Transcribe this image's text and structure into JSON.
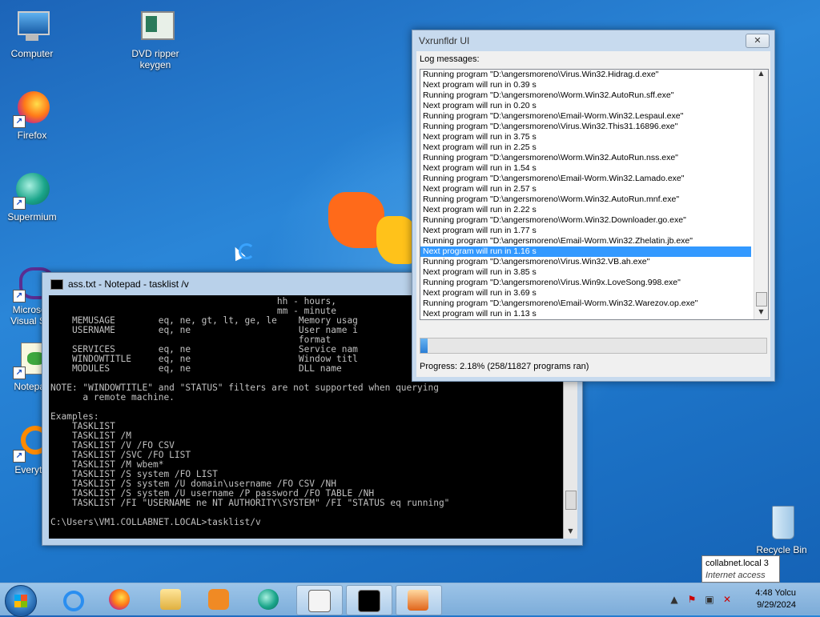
{
  "desktop": {
    "icons": [
      {
        "label": "Computer"
      },
      {
        "label": "DVD ripper keygen"
      },
      {
        "label": "Firefox"
      },
      {
        "label": "Supermium"
      },
      {
        "label": "Microsoft Visual Stu"
      },
      {
        "label": "Notepad"
      },
      {
        "label": "Everythi"
      },
      {
        "label": "Recycle Bin"
      }
    ]
  },
  "cmd_window": {
    "title": "ass.txt - Notepad - tasklist /v",
    "lines": [
      "                                          hh - hours,",
      "                                          mm - minute",
      "    MEMUSAGE        eq, ne, gt, lt, ge, le    Memory usag",
      "    USERNAME        eq, ne                    User name i",
      "                                              format",
      "    SERVICES        eq, ne                    Service nam",
      "    WINDOWTITLE     eq, ne                    Window titl",
      "    MODULES         eq, ne                    DLL name",
      "",
      "NOTE: \"WINDOWTITLE\" and \"STATUS\" filters are not supported when querying",
      "      a remote machine.",
      "",
      "Examples:",
      "    TASKLIST",
      "    TASKLIST /M",
      "    TASKLIST /V /FO CSV",
      "    TASKLIST /SVC /FO LIST",
      "    TASKLIST /M wbem*",
      "    TASKLIST /S system /FO LIST",
      "    TASKLIST /S system /U domain\\username /FO CSV /NH",
      "    TASKLIST /S system /U username /P password /FO TABLE /NH",
      "    TASKLIST /FI \"USERNAME ne NT AUTHORITY\\SYSTEM\" /FI \"STATUS eq running\"",
      "",
      "C:\\Users\\VM1.COLLABNET.LOCAL>tasklist/v"
    ]
  },
  "vx_window": {
    "title": "Vxrunfldr UI",
    "close_label": "✕",
    "log_label": "Log messages:",
    "log": [
      "Running program \"D:\\angersmoreno\\Virus.Win32.Hidrag.d.exe\"",
      "Next program will run in 0.39 s",
      "Running program \"D:\\angersmoreno\\Worm.Win32.AutoRun.sff.exe\"",
      "Next program will run in 0.20 s",
      "Running program \"D:\\angersmoreno\\Email-Worm.Win32.Lespaul.exe\"",
      "Running program \"D:\\angersmoreno\\Virus.Win32.This31.16896.exe\"",
      "Next program will run in 3.75 s",
      "Next program will run in 2.25 s",
      "Running program \"D:\\angersmoreno\\Worm.Win32.AutoRun.nss.exe\"",
      "Next program will run in 1.54 s",
      "Running program \"D:\\angersmoreno\\Email-Worm.Win32.Lamado.exe\"",
      "Next program will run in 2.57 s",
      "Running program \"D:\\angersmoreno\\Worm.Win32.AutoRun.mnf.exe\"",
      "Next program will run in 2.22 s",
      "Running program \"D:\\angersmoreno\\Worm.Win32.Downloader.go.exe\"",
      "Next program will run in 1.77 s",
      "Running program \"D:\\angersmoreno\\Email-Worm.Win32.Zhelatin.jb.exe\"",
      "Next program will run in 1.16 s",
      "Running program \"D:\\angersmoreno\\Virus.Win32.VB.ah.exe\"",
      "Next program will run in 3.85 s",
      "Running program \"D:\\angersmoreno\\Virus.Win9x.LoveSong.998.exe\"",
      "Next program will run in 3.69 s",
      "Running program \"D:\\angersmoreno\\Email-Worm.Win32.Warezov.op.exe\"",
      "Next program will run in 1.13 s"
    ],
    "selected_index": 17,
    "progress_fraction": 0.0218,
    "progress_text": "Progress: 2.18% (258/11827 programs ran)"
  },
  "tooltip": {
    "title": "collabnet.local  3",
    "subtitle": "Internet access"
  },
  "taskbar": {
    "clock_time": "4:48 Yolcu",
    "clock_date": "9/29/2024",
    "buttons": [
      {
        "name": "internet-explorer"
      },
      {
        "name": "firefox"
      },
      {
        "name": "file-explorer"
      },
      {
        "name": "media-player"
      },
      {
        "name": "supermium"
      },
      {
        "name": "notepad"
      },
      {
        "name": "command-prompt"
      },
      {
        "name": "vxrunfldr"
      }
    ]
  },
  "colors": {
    "selection": "#3399ff",
    "console_bg": "#000000",
    "console_fg": "#c0c0c0",
    "progress_fill": "#2b7fd6"
  }
}
